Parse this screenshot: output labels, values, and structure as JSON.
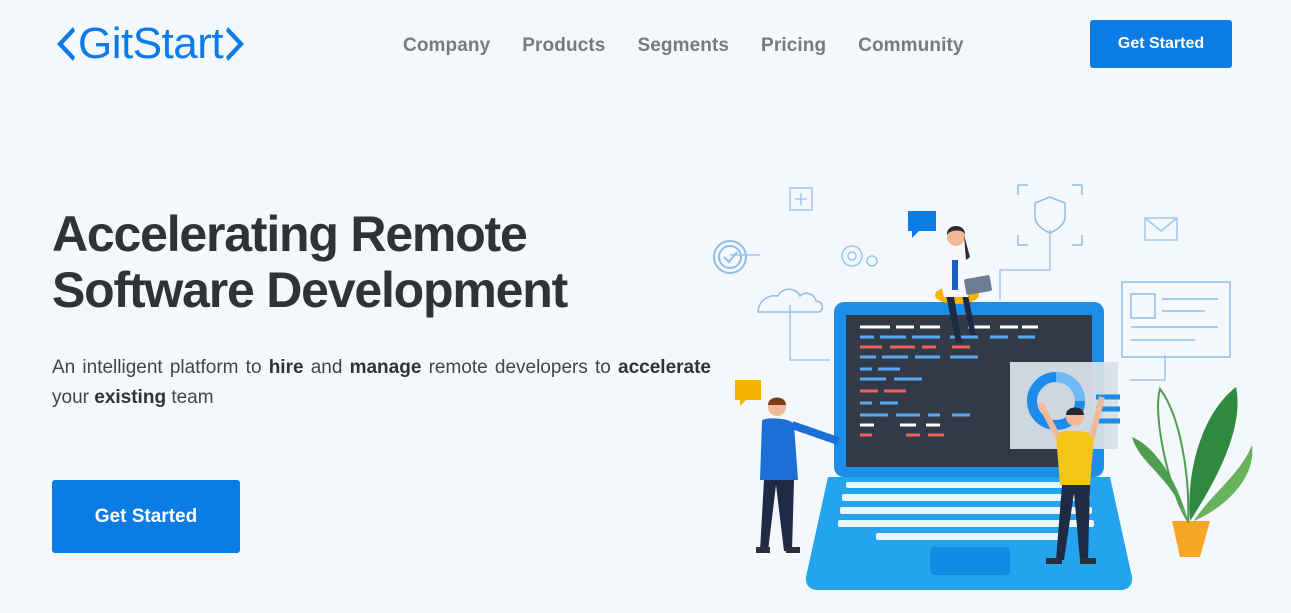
{
  "brand": {
    "name": "GitStart",
    "color": "#0b7be6"
  },
  "nav": {
    "items": [
      {
        "label": "Company"
      },
      {
        "label": "Products"
      },
      {
        "label": "Segments"
      },
      {
        "label": "Pricing"
      },
      {
        "label": "Community"
      }
    ]
  },
  "header": {
    "cta_label": "Get Started"
  },
  "hero": {
    "title_line1": "Accelerating Remote",
    "title_line2": "Software Development",
    "subtitle": {
      "p1": "An intelligent platform to ",
      "b1": "hire",
      "p2": " and ",
      "b2": "manage",
      "p3": " remote developers to ",
      "b3": "accelerate",
      "p4": " your ",
      "b4": "existing",
      "p5": " team"
    },
    "cta_label": "Get Started"
  },
  "illustration": {
    "icons": [
      "plus-square-icon",
      "chat-bubble-icon",
      "shield-icon",
      "mail-icon",
      "check-circle-icon",
      "gear-icon",
      "cloud-icon",
      "dashboard-card-icon",
      "plant-icon",
      "laptop-icon"
    ]
  },
  "colors": {
    "background": "#f4f7fb",
    "primary": "#0b7be6",
    "heading": "#2d3439",
    "nav_text": "#767b80"
  }
}
